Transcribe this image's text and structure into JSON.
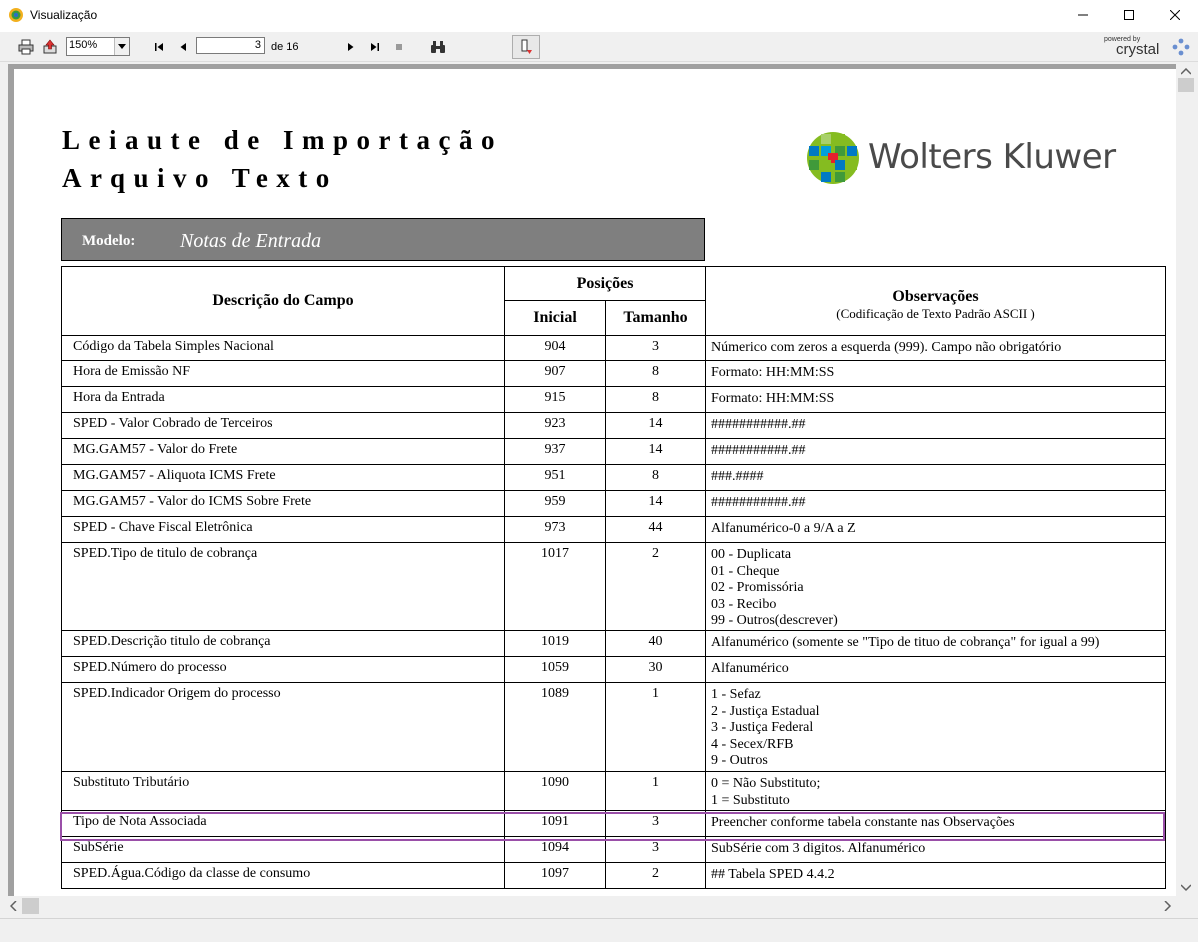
{
  "window": {
    "title": "Visualização"
  },
  "toolbar": {
    "zoom": "150%",
    "current_page": "3",
    "page_of": "de 16",
    "powered_by": "powered by",
    "brand": "crystal"
  },
  "report": {
    "title_line1": "Leiaute de Importação",
    "title_line2": "Arquivo Texto",
    "logo_text": "Wolters Kluwer",
    "modelo_label": "Modelo:",
    "modelo_value": "Notas de Entrada",
    "headers": {
      "descricao": "Descrição do Campo",
      "posicoes": "Posições",
      "inicial": "Inicial",
      "tamanho": "Tamanho",
      "observacoes": "Observações",
      "observacoes_sub": "(Codificação de Texto Padrão ASCII )"
    },
    "rows": [
      {
        "campo": "Código da Tabela Simples Nacional",
        "inicial": "904",
        "tamanho": "3",
        "obs": "Númerico com zeros a esquerda (999). Campo não obrigatório"
      },
      {
        "campo": "Hora de Emissão NF",
        "inicial": "907",
        "tamanho": "8",
        "obs": "Formato: HH:MM:SS"
      },
      {
        "campo": "Hora da Entrada",
        "inicial": "915",
        "tamanho": "8",
        "obs": "Formato: HH:MM:SS"
      },
      {
        "campo": "SPED - Valor Cobrado de Terceiros",
        "inicial": "923",
        "tamanho": "14",
        "obs": "###########.##"
      },
      {
        "campo": "MG.GAM57 - Valor do Frete",
        "inicial": "937",
        "tamanho": "14",
        "obs": "###########.##"
      },
      {
        "campo": "MG.GAM57 - Aliquota ICMS Frete",
        "inicial": "951",
        "tamanho": "8",
        "obs": "###.####"
      },
      {
        "campo": "MG.GAM57 - Valor do ICMS Sobre Frete",
        "inicial": "959",
        "tamanho": "14",
        "obs": "###########.##"
      },
      {
        "campo": "SPED - Chave Fiscal Eletrônica",
        "inicial": "973",
        "tamanho": "44",
        "obs": "Alfanumérico-0 a 9/A a Z"
      },
      {
        "campo": "SPED.Tipo de titulo de cobrança",
        "inicial": "1017",
        "tamanho": "2",
        "obs": "00 - Duplicata\n01 - Cheque\n02 - Promissória\n03 - Recibo\n99 - Outros(descrever)"
      },
      {
        "campo": "SPED.Descrição titulo de cobrança",
        "inicial": "1019",
        "tamanho": "40",
        "obs": "Alfanumérico (somente se \"Tipo de tituo de cobrança\" for igual a 99)"
      },
      {
        "campo": "SPED.Número do processo",
        "inicial": "1059",
        "tamanho": "30",
        "obs": "Alfanumérico"
      },
      {
        "campo": "SPED.Indicador Origem do processo",
        "inicial": "1089",
        "tamanho": "1",
        "obs": "1 - Sefaz\n2 - Justiça Estadual\n3 - Justiça Federal\n4 - Secex/RFB\n9 - Outros"
      },
      {
        "campo": "Substituto Tributário",
        "inicial": "1090",
        "tamanho": "1",
        "obs": "0 = Não Substituto;\n1 = Substituto"
      },
      {
        "campo": "Tipo de Nota Associada",
        "inicial": "1091",
        "tamanho": "3",
        "obs": "Preencher conforme tabela constante nas Observações"
      },
      {
        "campo": "SubSérie",
        "inicial": "1094",
        "tamanho": "3",
        "obs": "SubSérie com 3 digitos. Alfanumérico"
      },
      {
        "campo": "SPED.Água.Código da classe de consumo",
        "inicial": "1097",
        "tamanho": "2",
        "obs": "##    Tabela SPED 4.4.2"
      }
    ]
  },
  "colors": {
    "highlight": "#9a4fa8",
    "modelo_bg": "#7f7f7f",
    "logo_red": "#e5202e",
    "logo_green": "#85bc20",
    "logo_blue": "#007ac3"
  }
}
